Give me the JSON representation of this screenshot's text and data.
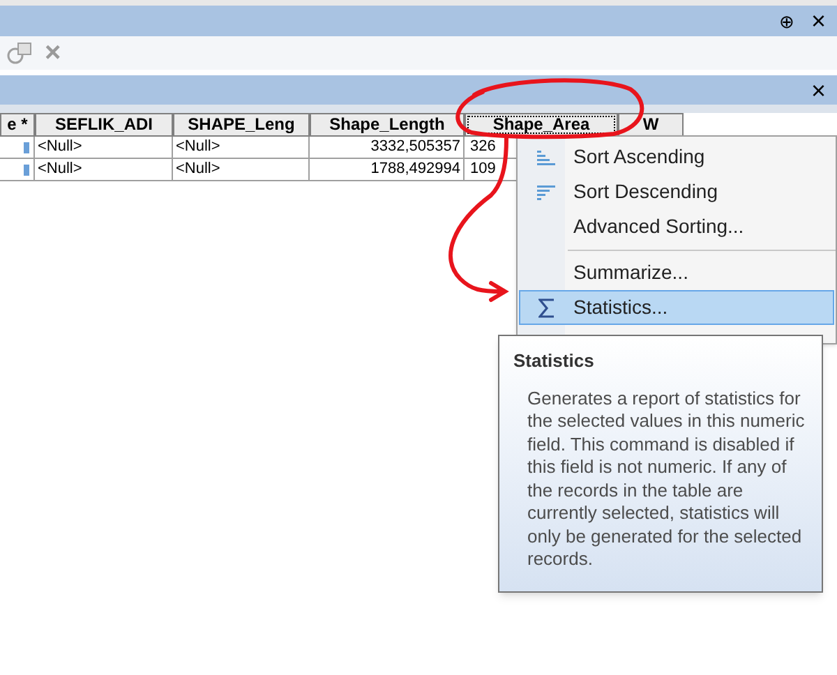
{
  "window": {
    "pin": "⊕",
    "close": "×"
  },
  "toolbar": {
    "close": "×"
  },
  "table_panel": {
    "close": "×"
  },
  "table": {
    "columns": [
      {
        "label": "e *",
        "selected": false
      },
      {
        "label": "SEFLIK_ADI",
        "selected": false
      },
      {
        "label": "SHAPE_Leng",
        "selected": false
      },
      {
        "label": "Shape_Length",
        "selected": false
      },
      {
        "label": "Shape_Area",
        "selected": true
      },
      {
        "label": "W",
        "selected": false
      }
    ],
    "rows": [
      [
        "",
        "<Null>",
        "<Null>",
        "3332,505357",
        "326"
      ],
      [
        "",
        "<Null>",
        "<Null>",
        "1788,492994",
        "109"
      ]
    ]
  },
  "context_menu": {
    "items": [
      {
        "kind": "sort_asc",
        "label": "Sort Ascending",
        "selected": false
      },
      {
        "kind": "sort_desc",
        "label": "Sort Descending",
        "selected": false
      },
      {
        "kind": "plain",
        "label": "Advanced Sorting...",
        "selected": false
      },
      {
        "kind": "separator"
      },
      {
        "kind": "plain",
        "label": "Summarize...",
        "selected": false
      },
      {
        "kind": "sigma",
        "label": "Statistics...",
        "selected": true
      }
    ]
  },
  "tooltip": {
    "title": "Statistics",
    "text": "Generates a report of statistics for the selected values in this numeric field. This command is disabled if this field is not numeric. If any of the records in the table are currently selected, statistics will only be generated for the selected records."
  }
}
